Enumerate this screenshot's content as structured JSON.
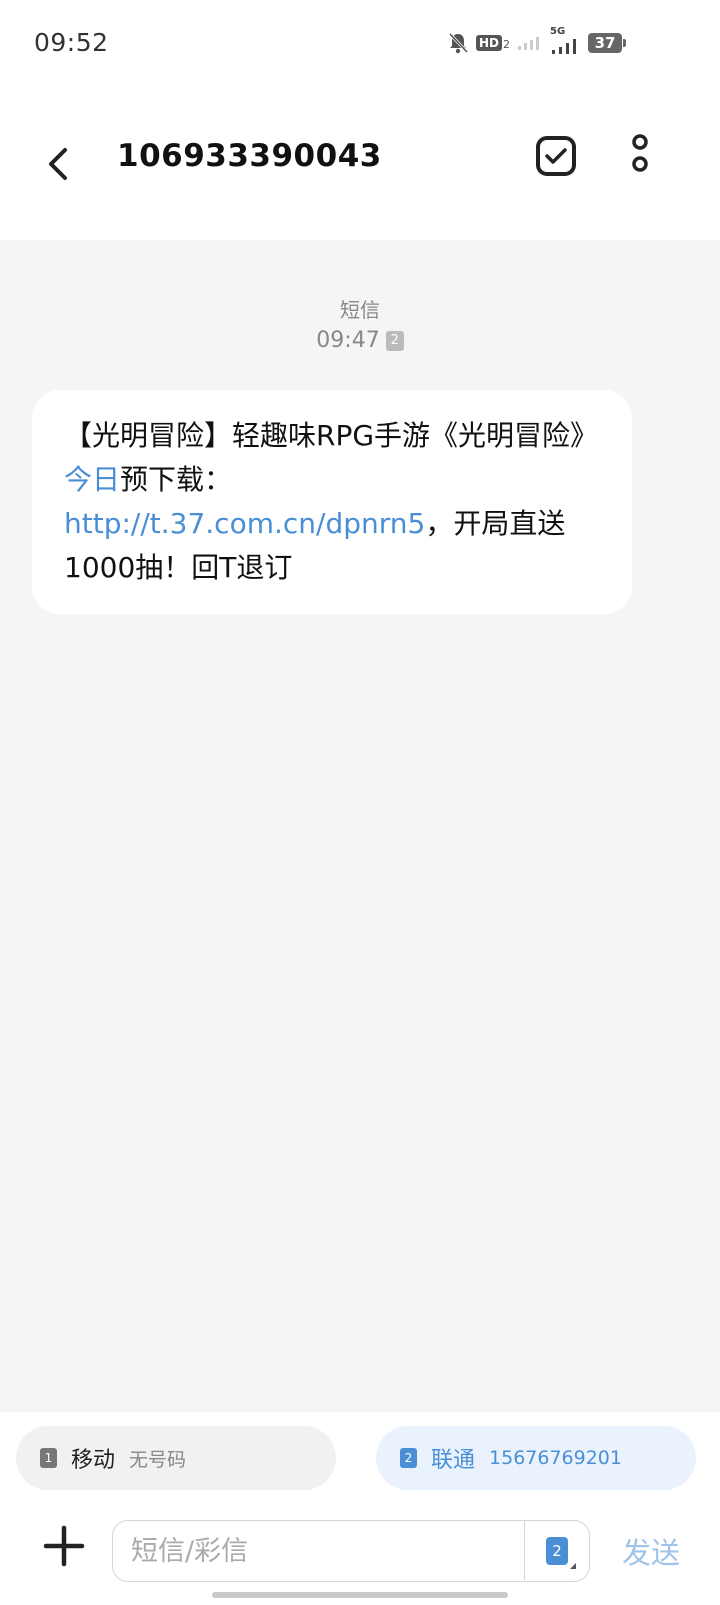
{
  "status_bar": {
    "time": "09:52",
    "hd_label": "HD",
    "hd_sub": "2",
    "network_label": "5G",
    "battery_level": "37"
  },
  "header": {
    "contact": "106933390043"
  },
  "messages": [
    {
      "type_label": "短信",
      "time": "09:47",
      "sim_slot": "2",
      "parts": {
        "p1": "【光明冒险】轻趣味RPG手游《光明冒险》",
        "p2": "今日",
        "p3": "预下载：",
        "link": "http://t.37.com.cn/dpnrn5",
        "p4": "，开局直送1000抽！回T退订"
      }
    }
  ],
  "sim_selector": [
    {
      "slot": "1",
      "carrier": "移动",
      "number": "无号码"
    },
    {
      "slot": "2",
      "carrier": "联通",
      "number": "15676769201"
    }
  ],
  "compose": {
    "placeholder": "短信/彩信",
    "sim_slot": "2",
    "send_label": "发送"
  },
  "colors": {
    "accent": "#4a8fd6",
    "send_disabled": "#9ec3ea",
    "conversation_bg": "#f5f5f5"
  }
}
